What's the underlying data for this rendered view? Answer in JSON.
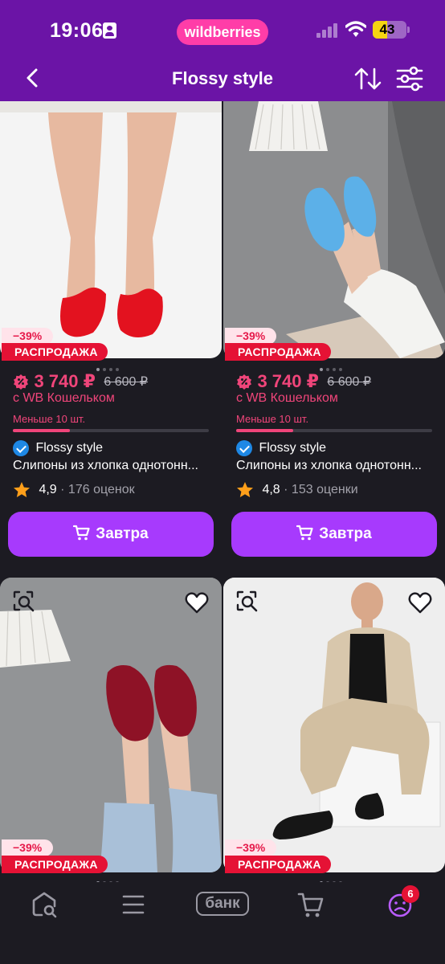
{
  "status_bar": {
    "time": "19:06",
    "brand": "wildberries",
    "battery": "43",
    "battery_level": 0.43
  },
  "nav": {
    "title": "Flossy style",
    "back_icon": "chevron-left-icon",
    "sort_icon": "sort-arrows-icon",
    "filter_icon": "sliders-icon"
  },
  "products": [
    {
      "discount": "−39%",
      "sale_label": "РАСПРОДАЖА",
      "price": "3 740 ₽",
      "old_price": "6 600 ₽",
      "wallet_note": "с WB Кошельком",
      "stock": "Меньше 10 шт.",
      "stock_level": 0.29,
      "brand": "Flossy style",
      "name": "Слипоны из хлопка однотонн...",
      "rating": "4,9",
      "reviews": "· 176 оценок",
      "buy_label": "Завтра",
      "shoe_color": "#e3121f"
    },
    {
      "discount": "−39%",
      "sale_label": "РАСПРОДАЖА",
      "price": "3 740 ₽",
      "old_price": "6 600 ₽",
      "wallet_note": "с WB Кошельком",
      "stock": "Меньше 10 шт.",
      "stock_level": 0.29,
      "brand": "Flossy style",
      "name": "Слипоны из хлопка однотонн...",
      "rating": "4,8",
      "reviews": "· 153 оценки",
      "buy_label": "Завтра",
      "shoe_color": "#5cb0e8"
    },
    {
      "discount": "−39%",
      "sale_label": "РАСПРОДАЖА",
      "shoe_color": "#8e1226"
    },
    {
      "discount": "−39%",
      "sale_label": "РАСПРОДАЖА",
      "shoe_color": "#161616"
    }
  ],
  "tabbar": {
    "items": [
      "home-search-icon",
      "menu-icon",
      "bank-icon",
      "cart-icon",
      "profile-icon"
    ],
    "bank_label": "банк",
    "profile_badge": "6"
  },
  "colors": {
    "header": "#6b14a6",
    "brand_pill": "#ff3da8",
    "price": "#f0457a",
    "sale": "#e51235",
    "button": "#a73afd",
    "background": "#1c1b22"
  }
}
